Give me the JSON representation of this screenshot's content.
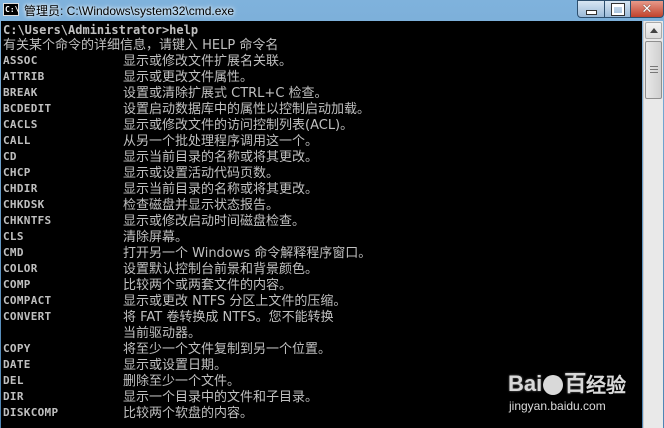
{
  "window": {
    "title": "管理员: C:\\Windows\\system32\\cmd.exe",
    "icon_text": "C:\\",
    "close_glyph": "✕"
  },
  "console": {
    "prompt": "C:\\Users\\Administrator>help",
    "header": "有关某个命令的详细信息，请键入 HELP 命令名",
    "entries": [
      {
        "cmd": "ASSOC",
        "desc": "显示或修改文件扩展名关联。"
      },
      {
        "cmd": "ATTRIB",
        "desc": "显示或更改文件属性。"
      },
      {
        "cmd": "BREAK",
        "desc": "设置或清除扩展式 CTRL+C 检查。"
      },
      {
        "cmd": "BCDEDIT",
        "desc": "设置启动数据库中的属性以控制启动加载。"
      },
      {
        "cmd": "CACLS",
        "desc": "显示或修改文件的访问控制列表(ACL)。"
      },
      {
        "cmd": "CALL",
        "desc": "从另一个批处理程序调用这一个。"
      },
      {
        "cmd": "CD",
        "desc": "显示当前目录的名称或将其更改。"
      },
      {
        "cmd": "CHCP",
        "desc": "显示或设置活动代码页数。"
      },
      {
        "cmd": "CHDIR",
        "desc": "显示当前目录的名称或将其更改。"
      },
      {
        "cmd": "CHKDSK",
        "desc": "检查磁盘并显示状态报告。"
      },
      {
        "cmd": "CHKNTFS",
        "desc": "显示或修改启动时间磁盘检查。"
      },
      {
        "cmd": "CLS",
        "desc": "清除屏幕。"
      },
      {
        "cmd": "CMD",
        "desc": "打开另一个 Windows 命令解释程序窗口。"
      },
      {
        "cmd": "COLOR",
        "desc": "设置默认控制台前景和背景颜色。"
      },
      {
        "cmd": "COMP",
        "desc": "比较两个或两套文件的内容。"
      },
      {
        "cmd": "COMPACT",
        "desc": "显示或更改 NTFS 分区上文件的压缩。"
      },
      {
        "cmd": "CONVERT",
        "desc": "将 FAT 卷转换成 NTFS。您不能转换"
      },
      {
        "cmd": "",
        "desc": "当前驱动器。"
      },
      {
        "cmd": "COPY",
        "desc": "将至少一个文件复制到另一个位置。"
      },
      {
        "cmd": "DATE",
        "desc": "显示或设置日期。"
      },
      {
        "cmd": "DEL",
        "desc": "删除至少一个文件。"
      },
      {
        "cmd": "DIR",
        "desc": "显示一个目录中的文件和子目录。"
      },
      {
        "cmd": "DISKCOMP",
        "desc": "比较两个软盘的内容。"
      }
    ]
  },
  "watermark": {
    "logo_left": "Bai",
    "logo_right": "百",
    "logo_cn": "经验",
    "url": "jingyan.baidu.com"
  },
  "colors": {
    "console_bg": "#000000",
    "console_text": "#c0c0c0",
    "close_button": "#c0422c"
  }
}
